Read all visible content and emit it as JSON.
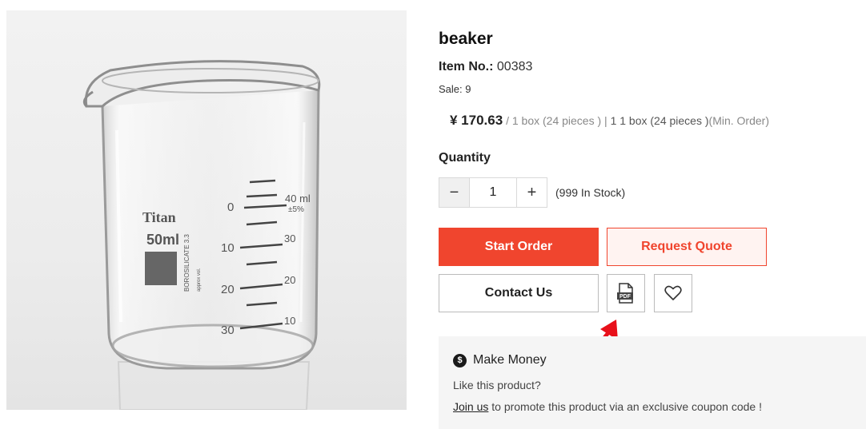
{
  "product": {
    "title": "beaker",
    "item_no_label": "Item No.:",
    "item_no": "00383",
    "sale": "Sale: 9",
    "price": "¥ 170.63",
    "price_unit": "/ 1 box (24 pieces )",
    "separator": "|",
    "min_order": "1 1 box (24 pieces )",
    "min_order_suffix": "(Min. Order)"
  },
  "image": {
    "brand": "Titan",
    "volume": "50ml",
    "glass_text": "BOROSILICATE 3.3",
    "approx_text": "approx vol.",
    "top_mark": "40 ml",
    "tolerance": "±5%",
    "left_scale": [
      "0",
      "10",
      "20",
      "30"
    ],
    "right_scale": [
      "30",
      "20",
      "10"
    ]
  },
  "quantity": {
    "label": "Quantity",
    "minus": "−",
    "value": "1",
    "plus": "+",
    "stock": "(999 In Stock)"
  },
  "actions": {
    "start_order": "Start Order",
    "request_quote": "Request Quote",
    "contact_us": "Contact Us",
    "pdf_icon_text": "PDF"
  },
  "make_money": {
    "icon_text": "$",
    "title": "Make Money",
    "question": "Like this product?",
    "join_link": "Join us",
    "promo_text": " to promote this product via an exclusive coupon code !"
  },
  "colors": {
    "accent": "#f0452e",
    "annotation_arrow": "#e8101a"
  }
}
